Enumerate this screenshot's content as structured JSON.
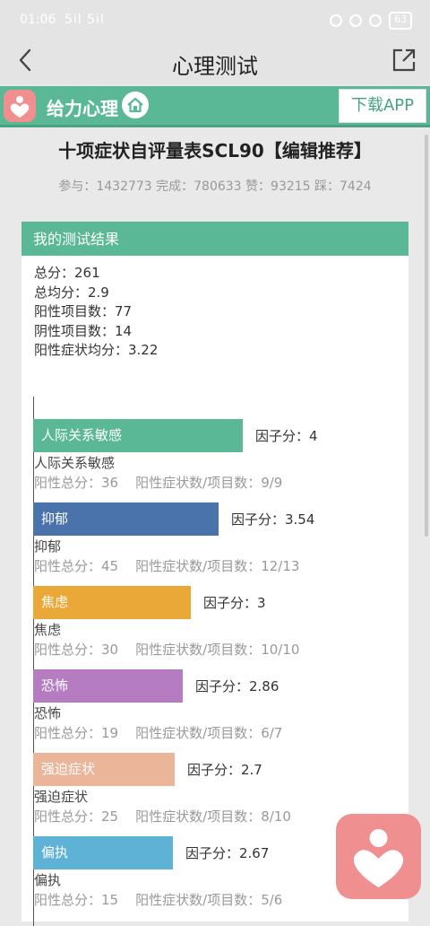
{
  "status": {
    "time": "01:06",
    "signal": "5il 5il",
    "battery": "63"
  },
  "nav": {
    "title": "心理测试"
  },
  "brand": {
    "name": "给力心理",
    "download_label": "下载APP"
  },
  "test": {
    "title": "十项症状自评量表SCL90【编辑推荐】",
    "stats": "参与：1432773 完成：780633 赞：93215 踩：7424"
  },
  "result": {
    "header": "我的测试结果",
    "summary": [
      "总分：261",
      "总均分：2.9",
      "阳性项目数：77",
      "阴性项目数：14",
      "阳性症状均分：3.22"
    ]
  },
  "factors": [
    {
      "label": "人际关系敏感",
      "value": 4,
      "score_text": "因子分：4",
      "name": "人际关系敏感",
      "detail": "阳性总分：36    阳性症状数/项目数：9/9",
      "color": "#5ab896"
    },
    {
      "label": "抑郁",
      "value": 3.54,
      "score_text": "因子分：3.54",
      "name": "抑郁",
      "detail": "阳性总分：45    阳性症状数/项目数：12/13",
      "color": "#4a72ab"
    },
    {
      "label": "焦虑",
      "value": 3,
      "score_text": "因子分：3",
      "name": "焦虑",
      "detail": "阳性总分：30    阳性症状数/项目数：10/10",
      "color": "#e9a838"
    },
    {
      "label": "恐怖",
      "value": 2.86,
      "score_text": "因子分：2.86",
      "name": "恐怖",
      "detail": "阳性总分：19    阳性症状数/项目数：6/7",
      "color": "#b57cc2"
    },
    {
      "label": "强迫症状",
      "value": 2.7,
      "score_text": "因子分：2.7",
      "name": "强迫症状",
      "detail": "阳性总分：25    阳性症状数/项目数：8/10",
      "color": "#ebb59a"
    },
    {
      "label": "偏执",
      "value": 2.67,
      "score_text": "因子分：2.67",
      "name": "偏执",
      "detail": "阳性总分：15    阳性症状数/项目数：5/6",
      "color": "#5eb2d6"
    }
  ],
  "icons": {
    "back": "chevron-left-icon",
    "share": "external-link-icon",
    "logo": "heart-person-icon",
    "home": "home-icon"
  }
}
